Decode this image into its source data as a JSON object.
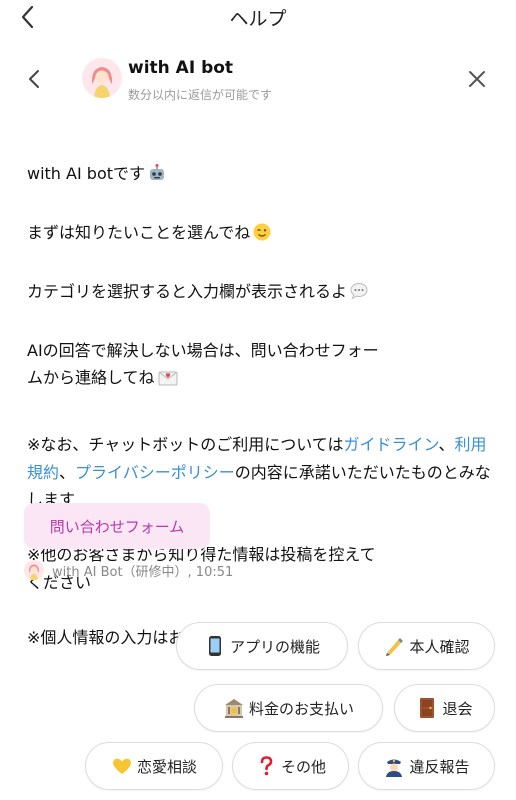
{
  "page": {
    "title": "ヘルプ"
  },
  "chat_header": {
    "bot_name": "with AI bot",
    "status": "数分以内に返信が可能です"
  },
  "message": {
    "line1": "with AI botです",
    "line2": "まずは知りたいことを選んでね",
    "line3": "カテゴリを選択すると入力欄が表示されるよ",
    "line4": "AIの回答で解決しない場合は、問い合わせフォー\nムから連絡してね",
    "notice_prefix": "※なお、チャットボットのご利用については",
    "link_guideline": "ガイドライン",
    "sep1": "、",
    "link_terms": "利用規約",
    "sep2": "、",
    "link_privacy": "プライバシーポリシー",
    "notice_suffix": "の内容に承諾いただいたものとみなします",
    "notice2": "※他のお客さまから知り得た情報は投稿を控えて\nください",
    "notice3": "※個人情報の入力はお控えください"
  },
  "form_button": {
    "label": "問い合わせフォーム"
  },
  "meta": {
    "sender_time": "with AI Bot（研修中）, 10:51"
  },
  "quick_replies": [
    {
      "label": "アプリの機能",
      "icon": "phone-icon"
    },
    {
      "label": "本人確認",
      "icon": "pen-icon"
    },
    {
      "label": "料金のお支払い",
      "icon": "bank-icon"
    },
    {
      "label": "退会",
      "icon": "door-icon"
    },
    {
      "label": "恋愛相談",
      "icon": "yellow-heart-icon"
    },
    {
      "label": "その他",
      "icon": "question-icon"
    },
    {
      "label": "違反報告",
      "icon": "police-icon"
    }
  ],
  "colors": {
    "link": "#3b8fd6",
    "form_bg": "#fbe6f6",
    "form_text": "#b83aa8"
  }
}
